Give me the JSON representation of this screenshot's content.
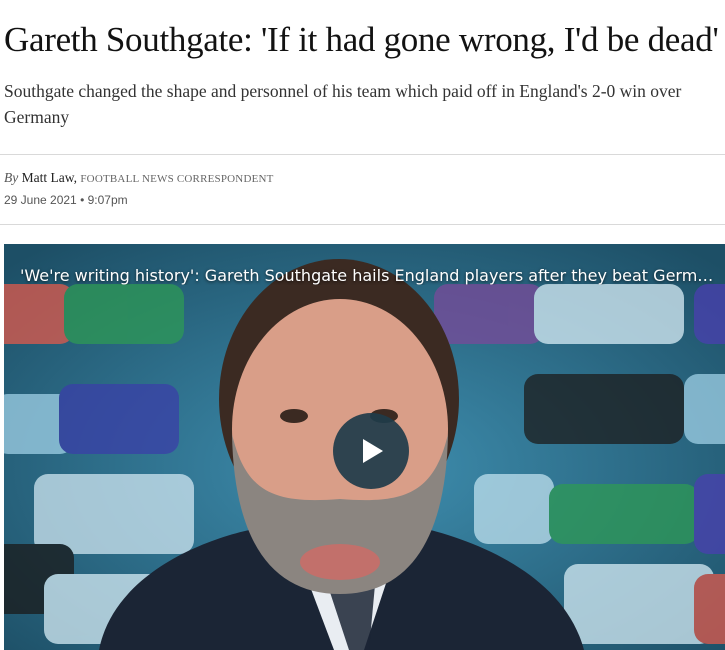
{
  "article": {
    "headline": "Gareth Southgate: 'If it had gone wrong, I'd be dead'",
    "standfirst": "Southgate changed the shape and personnel of his team which paid off in England's 2-0 win over Germany",
    "byline": {
      "prefix": "By",
      "author": "Matt Law,",
      "role": "FOOTBALL NEWS CORRESPONDENT"
    },
    "date": "29 June 2021 • 9:07pm"
  },
  "video": {
    "title": "'We're writing history': Gareth Southgate hails England players after they beat Germany ...",
    "play_icon": "play-icon",
    "colors": {
      "play_button_bg": "#203c4a",
      "board_bg": "#2b6f8c"
    }
  }
}
